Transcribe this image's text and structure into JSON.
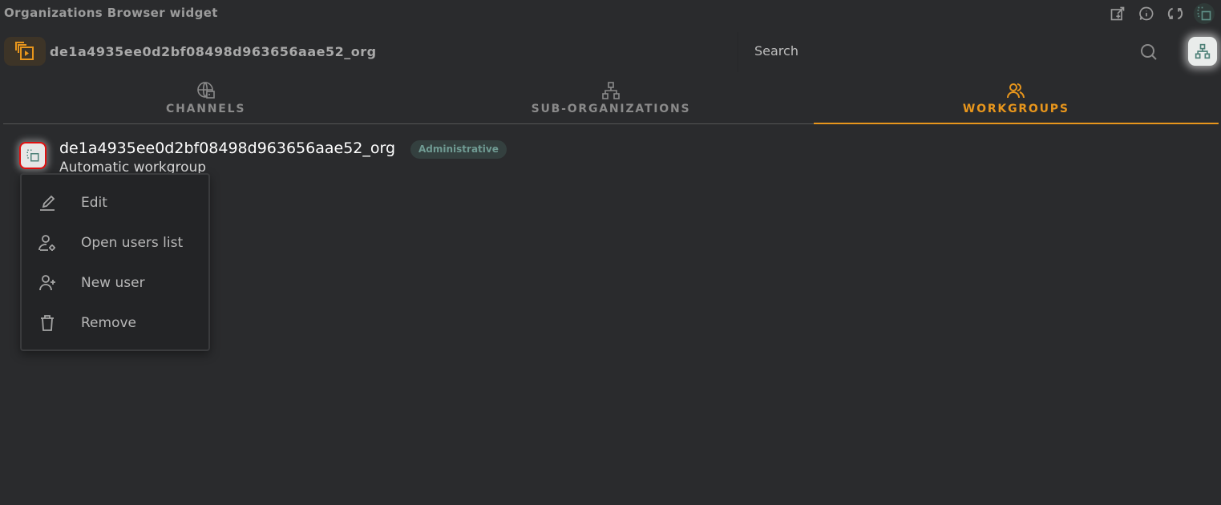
{
  "window": {
    "title": "Organizations Browser widget",
    "toolbar_icons": [
      "new-window-icon",
      "info-icon",
      "refresh-icon",
      "select-icon"
    ]
  },
  "organization": {
    "name": "de1a4935ee0d2bf08498d963656aae52_org",
    "icon": "organization-icon"
  },
  "search": {
    "placeholder": "Search",
    "value": ""
  },
  "hierarchy_button": {
    "icon": "hierarchy-icon"
  },
  "tabs": [
    {
      "label": "CHANNELS",
      "icon": "globe-icon",
      "active": false
    },
    {
      "label": "SUB-ORGANIZATIONS",
      "icon": "hierarchy-icon",
      "active": false
    },
    {
      "label": "WORKGROUPS",
      "icon": "users-icon",
      "active": true
    }
  ],
  "workgroups": [
    {
      "name": "de1a4935ee0d2bf08498d963656aae52_org",
      "badge": "Administrative",
      "description": "Automatic workgroup"
    }
  ],
  "context_menu": {
    "items": [
      {
        "label": "Edit",
        "icon": "edit-icon"
      },
      {
        "label": "Open users list",
        "icon": "user-settings-icon"
      },
      {
        "label": "New user",
        "icon": "user-add-icon"
      },
      {
        "label": "Remove",
        "icon": "trash-icon"
      }
    ]
  },
  "colors": {
    "accent": "#e8961c",
    "background": "#2a2b2d",
    "badge_text": "#6f9a92",
    "selection_outline": "#e01010"
  }
}
